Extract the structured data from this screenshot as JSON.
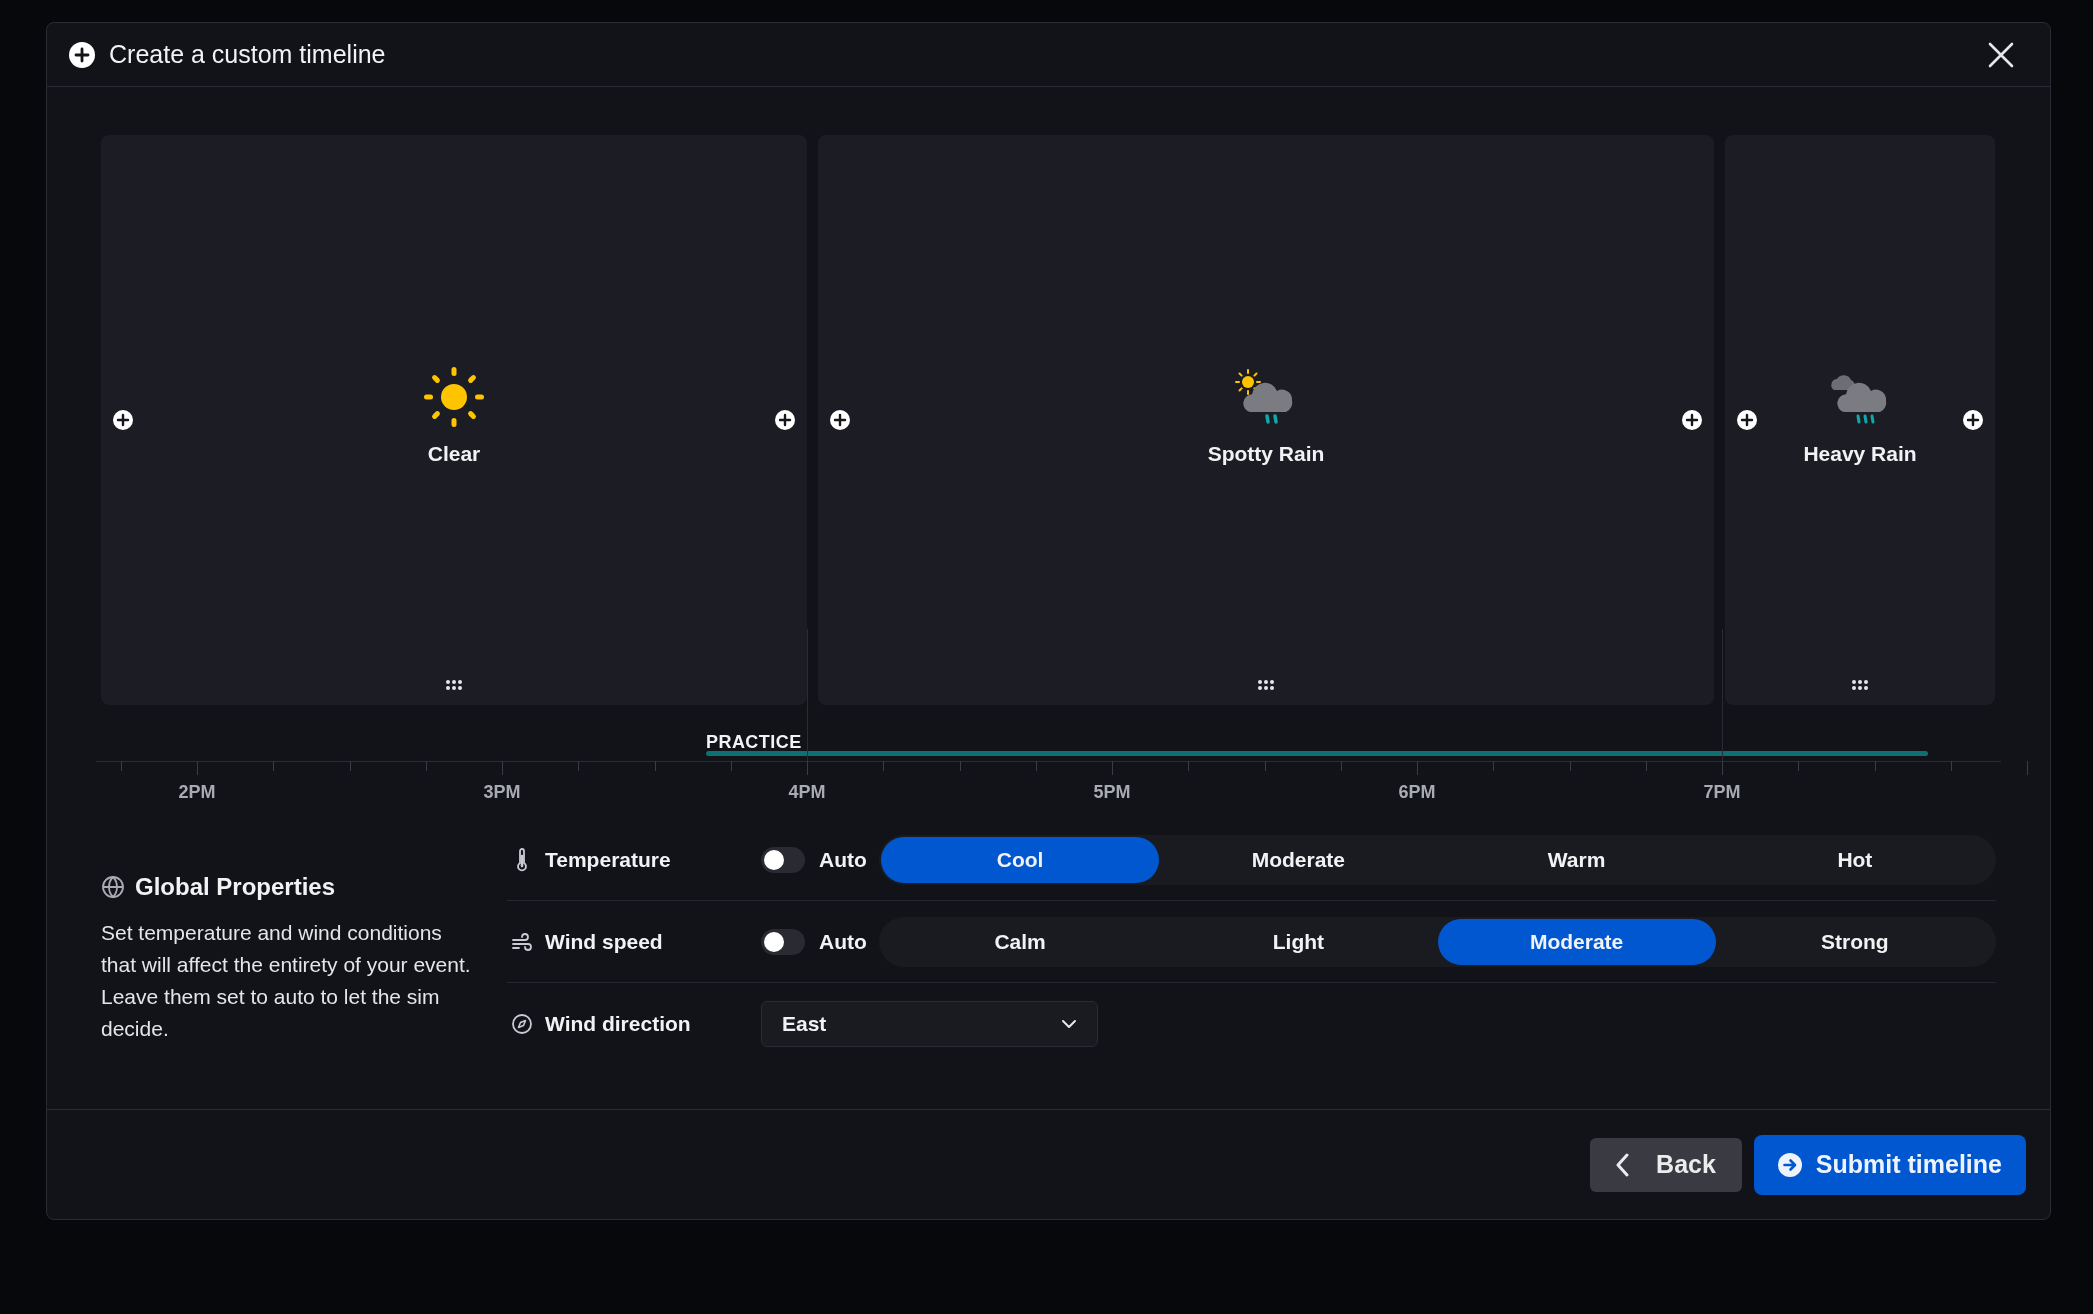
{
  "window": {
    "title": "Create a custom timeline"
  },
  "segments": [
    {
      "kind": "clear",
      "label": "Clear"
    },
    {
      "kind": "spotty_rain",
      "label": "Spotty Rain"
    },
    {
      "kind": "heavy_rain",
      "label": "Heavy Rain"
    }
  ],
  "timeline": {
    "session_label": "PRACTICE",
    "hours": [
      "2PM",
      "3PM",
      "4PM",
      "5PM",
      "6PM",
      "7PM"
    ]
  },
  "global_properties": {
    "title": "Global Properties",
    "description": "Set temperature and wind conditions that will affect the entirety of your event. Leave them set to auto to let the sim decide."
  },
  "properties": [
    {
      "kind": "segmented",
      "label": "Temperature",
      "auto": {
        "label": "Auto",
        "on": false
      },
      "options": [
        {
          "label": "Cool",
          "selected": true
        },
        {
          "label": "Moderate",
          "selected": false
        },
        {
          "label": "Warm",
          "selected": false
        },
        {
          "label": "Hot",
          "selected": false
        }
      ]
    },
    {
      "kind": "segmented",
      "label": "Wind speed",
      "auto": {
        "label": "Auto",
        "on": false
      },
      "options": [
        {
          "label": "Calm",
          "selected": false
        },
        {
          "label": "Light",
          "selected": false
        },
        {
          "label": "Moderate",
          "selected": true
        },
        {
          "label": "Strong",
          "selected": false
        }
      ]
    },
    {
      "kind": "select",
      "label": "Wind direction",
      "value": "East"
    }
  ],
  "buttons": [
    {
      "kind": "back",
      "label": "Back"
    },
    {
      "kind": "submit",
      "label": "Submit timeline"
    }
  ]
}
